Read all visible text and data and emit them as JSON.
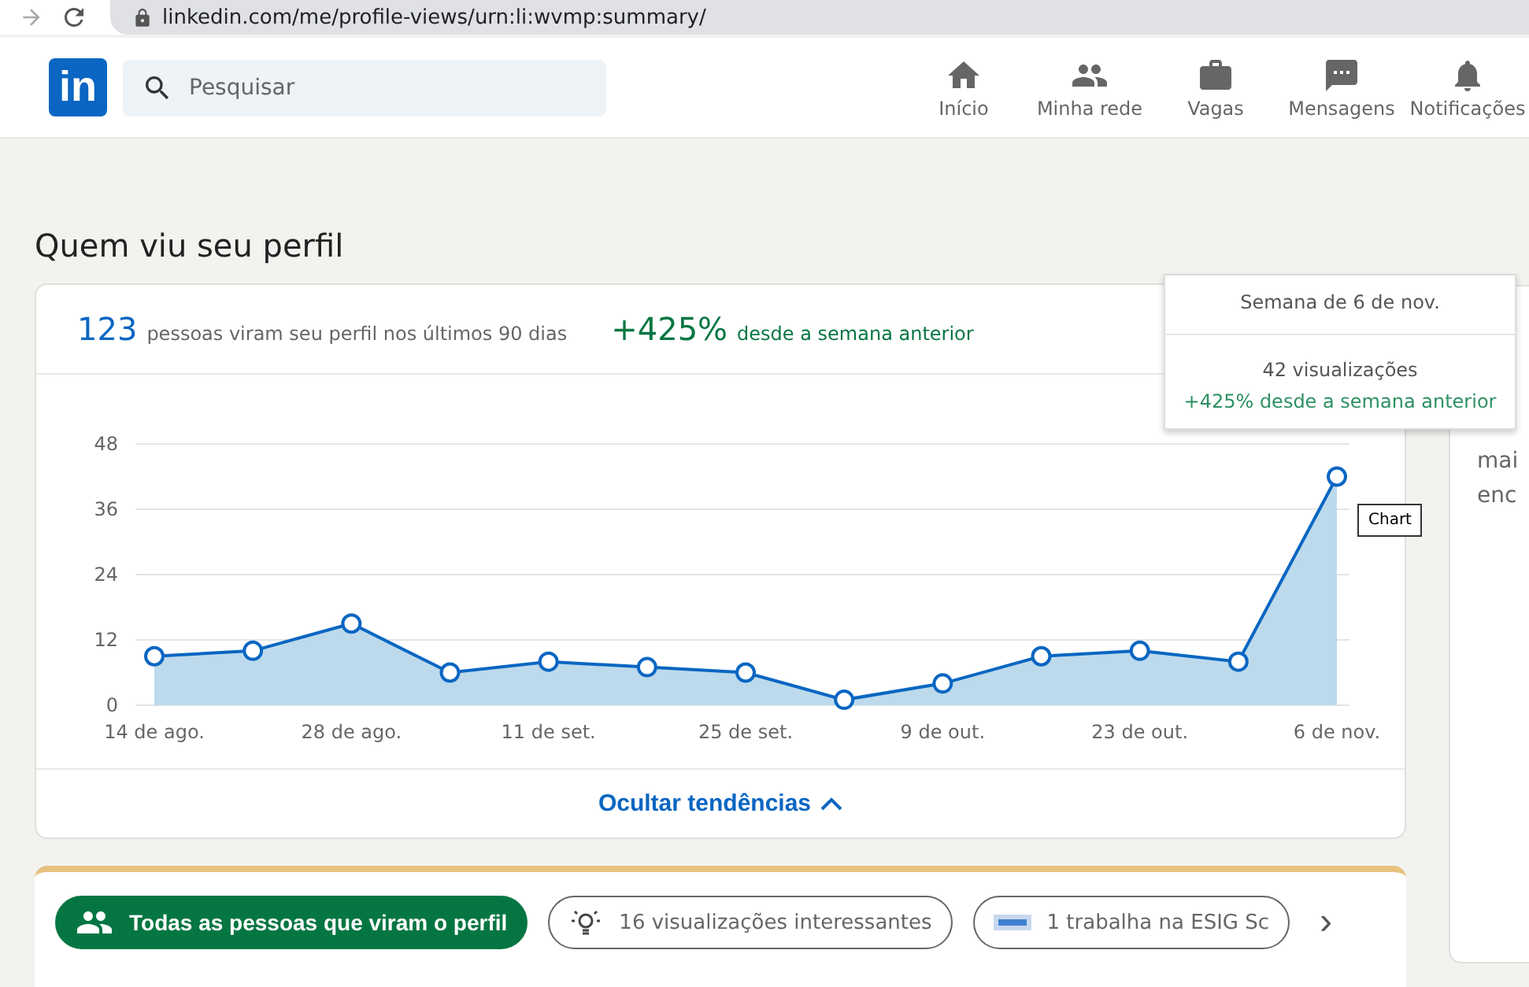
{
  "browser": {
    "url": "linkedin.com/me/profile-views/urn:li:wvmp:summary/"
  },
  "nav": {
    "logo": "in",
    "search": {
      "placeholder": "Pesquisar"
    },
    "items": [
      {
        "label": "Início"
      },
      {
        "label": "Minha rede"
      },
      {
        "label": "Vagas"
      },
      {
        "label": "Mensagens"
      },
      {
        "label": "Notificações"
      }
    ]
  },
  "page_title": "Quem viu seu perfil",
  "summary": {
    "count": "123",
    "count_text": "pessoas viram seu perfil nos últimos 90 dias",
    "change": "+425%",
    "change_text": "desde a semana anterior"
  },
  "chart_data": {
    "type": "area",
    "categories": [
      "14 de ago.",
      null,
      "28 de ago.",
      null,
      "11 de set.",
      null,
      "25 de set.",
      null,
      "9 de out.",
      null,
      "23 de out.",
      null,
      "6 de nov."
    ],
    "series": [
      {
        "color": "#0a66c2",
        "values": [
          9,
          10,
          15,
          6,
          8,
          7,
          6,
          1,
          4,
          9,
          10,
          8,
          42
        ]
      }
    ],
    "ylim": [
      0,
      48
    ],
    "yticks": [
      0,
      12,
      24,
      36,
      48
    ],
    "grid": true
  },
  "tooltip": {
    "title": "Semana de 6 de nov.",
    "views": "42 visualizações",
    "change": "+425% desde a semana anterior"
  },
  "hover_label": "Chart",
  "toggle": "Ocultar tendências",
  "filters": [
    {
      "label": "Todas as pessoas que viram o perfil",
      "selected": true
    },
    {
      "label": "16 visualizações interessantes",
      "selected": false
    },
    {
      "label": "1 trabalha na ESIG Sc",
      "selected": false
    }
  ],
  "next": "›",
  "side_card": {
    "lines": [
      "mai",
      "enc"
    ]
  }
}
